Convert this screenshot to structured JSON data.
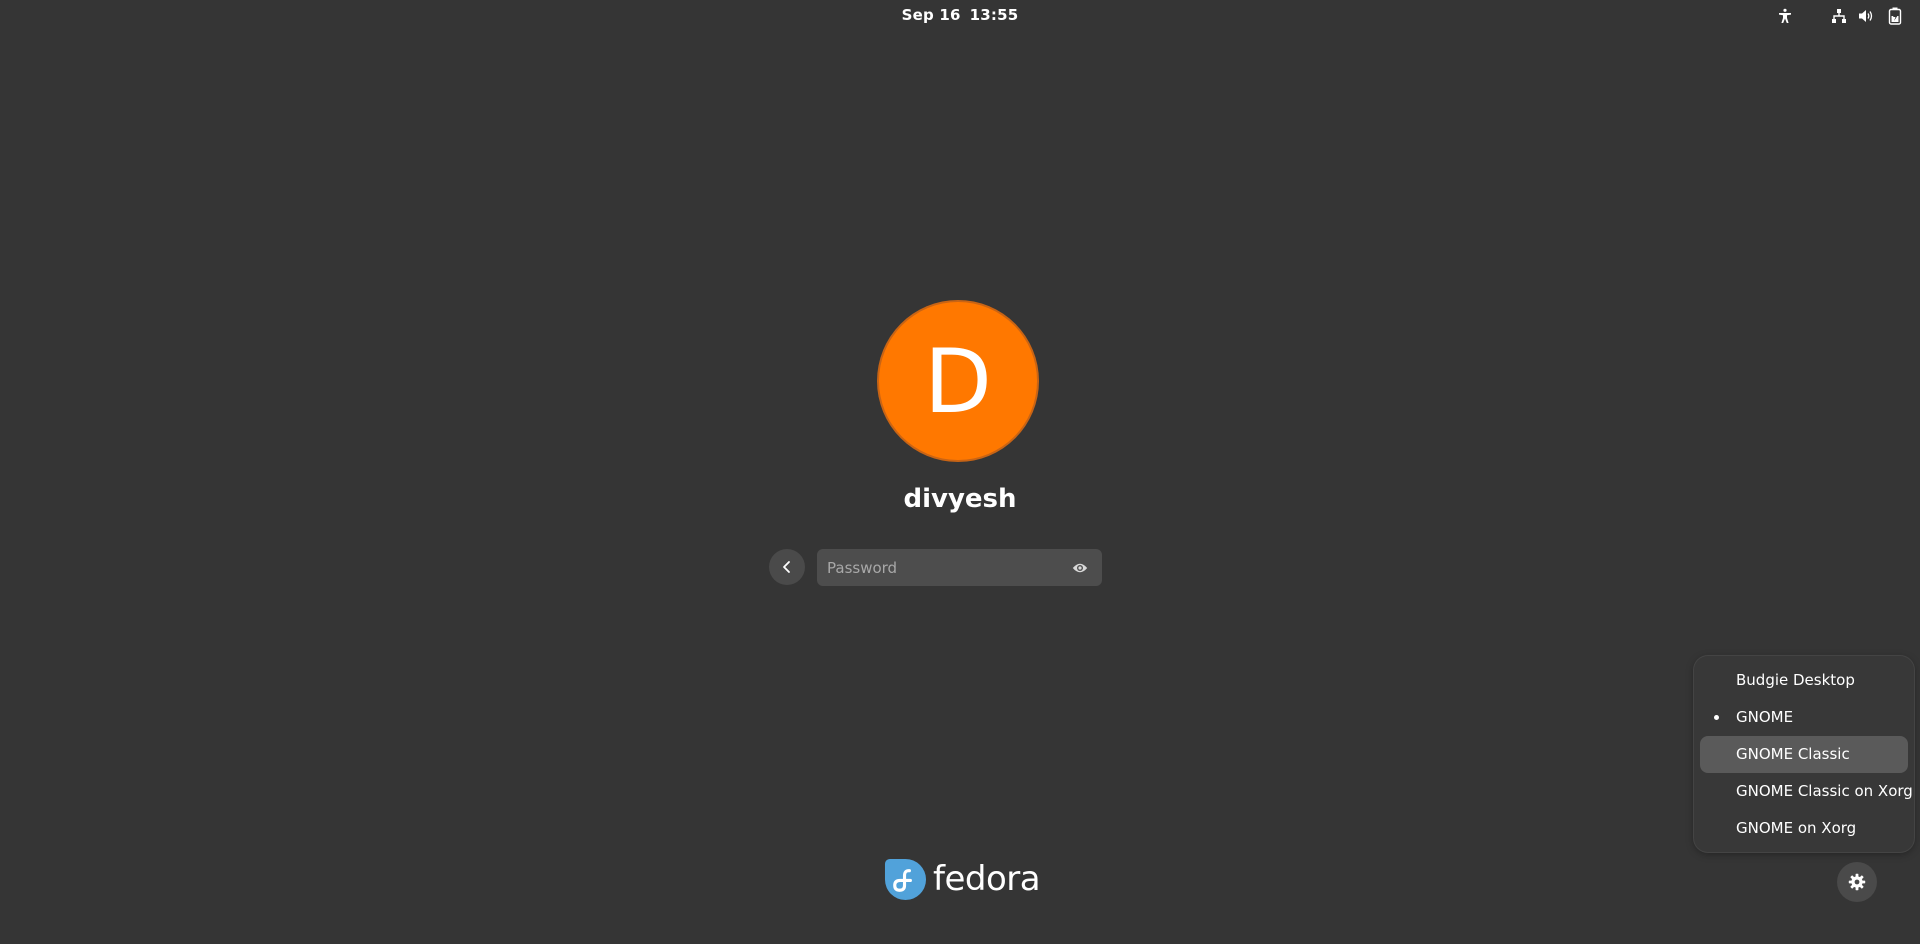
{
  "topbar": {
    "date": "Sep 16",
    "time": "13:55",
    "icons": [
      "accessibility-icon",
      "network-wired-icon",
      "volume-icon",
      "battery-icon"
    ]
  },
  "login": {
    "avatar_initial": "D",
    "avatar_color": "#ff7800",
    "username": "divyesh",
    "password_placeholder": "Password",
    "password_value": ""
  },
  "branding": {
    "logo_text": "fedora",
    "logo_color": "#51a2da"
  },
  "session_menu": {
    "items": [
      {
        "label": "Budgie Desktop",
        "selected": false
      },
      {
        "label": "GNOME",
        "selected": true
      },
      {
        "label": "GNOME Classic",
        "selected": false,
        "hovered": true
      },
      {
        "label": "GNOME Classic on Xorg",
        "selected": false
      },
      {
        "label": "GNOME on Xorg",
        "selected": false
      }
    ]
  },
  "colors": {
    "background": "#353535",
    "menu_background": "#383838",
    "menu_hover": "#5a5a5a",
    "button_background": "#4a4a4a"
  }
}
